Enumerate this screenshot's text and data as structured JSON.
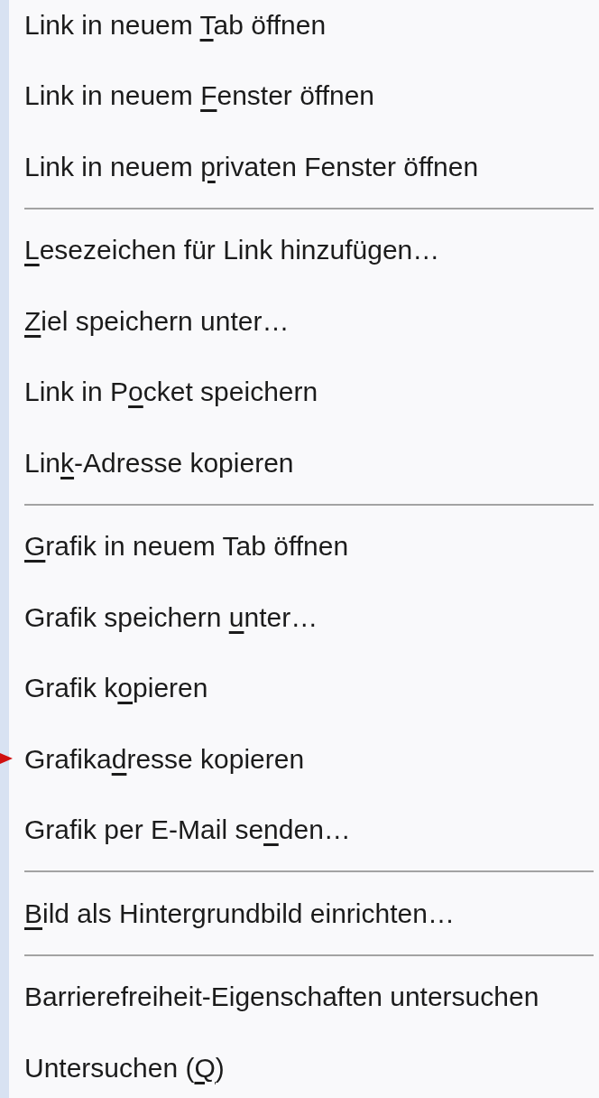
{
  "menu": {
    "items": [
      {
        "kind": "item",
        "label": "Link in neuem ",
        "access_key": "T",
        "label_rest": "ab öffnen",
        "pointed": false
      },
      {
        "kind": "item",
        "label": "Link in neuem ",
        "access_key": "F",
        "label_rest": "enster öffnen",
        "pointed": false
      },
      {
        "kind": "item",
        "label": "Link in neuem ",
        "access_key": "p",
        "label_rest": "rivaten Fenster öffnen",
        "pointed": false
      },
      {
        "kind": "separator"
      },
      {
        "kind": "item",
        "access_key": "L",
        "label_rest": "esezeichen für Link hinzufügen…",
        "pointed": false
      },
      {
        "kind": "item",
        "access_key": "Z",
        "label_rest": "iel speichern unter…",
        "pointed": false
      },
      {
        "kind": "item",
        "label": "Link in P",
        "access_key": "o",
        "label_rest": "cket speichern",
        "pointed": false
      },
      {
        "kind": "item",
        "label": "Lin",
        "access_key": "k",
        "label_rest": "-Adresse kopieren",
        "pointed": false
      },
      {
        "kind": "separator"
      },
      {
        "kind": "item",
        "access_key": "G",
        "label_rest": "rafik in neuem Tab öffnen",
        "pointed": false
      },
      {
        "kind": "item",
        "label": "Grafik speichern ",
        "access_key": "u",
        "label_rest": "nter…",
        "pointed": false
      },
      {
        "kind": "item",
        "label": "Grafik k",
        "access_key": "o",
        "label_rest": "pieren",
        "pointed": false
      },
      {
        "kind": "item",
        "label": "Grafika",
        "access_key": "d",
        "label_rest": "resse kopieren",
        "pointed": true
      },
      {
        "kind": "item",
        "label": "Grafik per E-Mail se",
        "access_key": "n",
        "label_rest": "den…",
        "pointed": false
      },
      {
        "kind": "separator"
      },
      {
        "kind": "item",
        "access_key": "B",
        "label_rest": "ild als Hintergrundbild einrichten…",
        "pointed": false
      },
      {
        "kind": "separator"
      },
      {
        "kind": "item",
        "label": "Barrierefreiheit-Eigenschaften untersuchen",
        "pointed": false
      },
      {
        "kind": "item",
        "label": "Untersuchen (",
        "access_key": "Q",
        "label_rest": ")",
        "pointed": false
      }
    ]
  }
}
